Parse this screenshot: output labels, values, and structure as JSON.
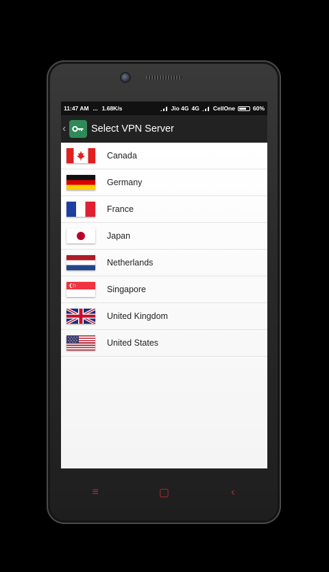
{
  "status_bar": {
    "time": "11:47 AM",
    "dots": "...",
    "speed": "1.68K/s",
    "carrier1": "Jio 4G",
    "net": "4G",
    "carrier2": "CellOne",
    "battery": "60%"
  },
  "app_bar": {
    "back_glyph": "‹",
    "icon_glyph": "🔑",
    "title": "Select VPN Server"
  },
  "servers": [
    {
      "label": "Canada",
      "flag": "canada-flag"
    },
    {
      "label": "Germany",
      "flag": "germany-flag"
    },
    {
      "label": "France",
      "flag": "france-flag"
    },
    {
      "label": "Japan",
      "flag": "japan-flag"
    },
    {
      "label": "Netherlands",
      "flag": "netherlands-flag"
    },
    {
      "label": "Singapore",
      "flag": "singapore-flag"
    },
    {
      "label": "United Kingdom",
      "flag": "uk-flag"
    },
    {
      "label": "United States",
      "flag": "us-flag"
    }
  ],
  "nav": {
    "menu_glyph": "≡",
    "home_glyph": "▢",
    "back_glyph": "‹"
  },
  "colors": {
    "accent": "#c0272d",
    "app_icon": "#2e8b57",
    "app_bar": "#222222"
  }
}
